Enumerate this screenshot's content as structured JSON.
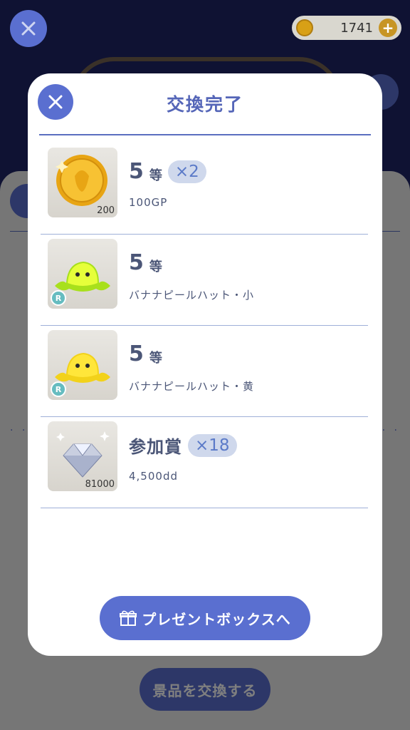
{
  "header": {
    "coin_amount": "1741"
  },
  "background": {
    "exchange_button": "景品を交換する"
  },
  "modal": {
    "title": "交換完了",
    "items": [
      {
        "rank_num": "5",
        "rank_unit": "等",
        "multiplier": "×2",
        "description": "100GP",
        "thumb_qty": "200",
        "thumb_icon": "gold-coin-icon"
      },
      {
        "rank_num": "5",
        "rank_unit": "等",
        "multiplier": "",
        "description": "バナナピールハット・小",
        "thumb_badge": "R",
        "thumb_icon": "banana-peel-hat-icon"
      },
      {
        "rank_num": "5",
        "rank_unit": "等",
        "multiplier": "",
        "description": "バナナピールハット・黄",
        "thumb_badge": "R",
        "thumb_icon": "banana-peel-hat-icon"
      },
      {
        "rank_label": "参加賞",
        "multiplier": "×18",
        "description": "4,500dd",
        "thumb_qty": "81000",
        "thumb_icon": "diamond-icon"
      }
    ],
    "present_button": "プレゼントボックスへ"
  },
  "colors": {
    "accent": "#5a6fd0",
    "title": "#5566b8",
    "text": "#4b5677",
    "pill": "#cfd8ec"
  }
}
